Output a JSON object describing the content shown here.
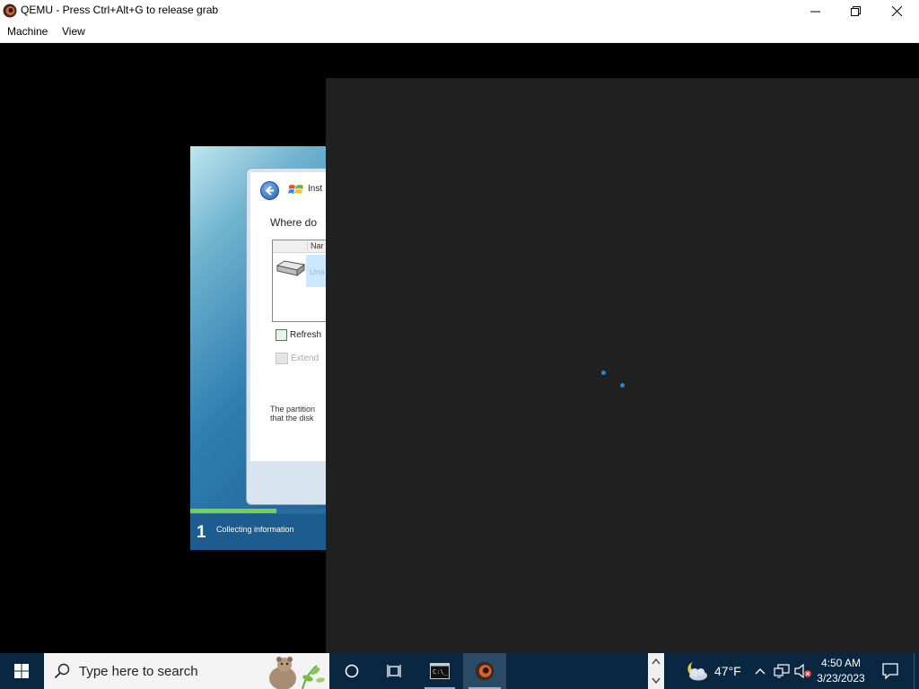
{
  "window": {
    "title": "QEMU - Press Ctrl+Alt+G to release grab",
    "icon": "qemu-icon",
    "controls": [
      "minimize-icon",
      "maximize-icon",
      "close-icon"
    ]
  },
  "menu": {
    "items": [
      "Machine",
      "View"
    ]
  },
  "guest": {
    "setup_dialog": {
      "title_partial": "Inst",
      "prompt_partial": "Where do",
      "list_header_partial": "Nar",
      "disk_label_partial": "Una",
      "refresh_label": "Refresh",
      "extend_label": "Extend",
      "partition_note_line1": "The partition",
      "partition_note_line2": "that the disk"
    },
    "progress_fraction": 0.63,
    "step": {
      "number": "1",
      "label": "Collecting information"
    },
    "spinner_color": "#1a88e6"
  },
  "taskbar": {
    "search_placeholder": "Type here to search",
    "weather_temp": "47°F",
    "time": "4:50 AM",
    "date": "3/23/2023",
    "accent": "#0a2741"
  }
}
